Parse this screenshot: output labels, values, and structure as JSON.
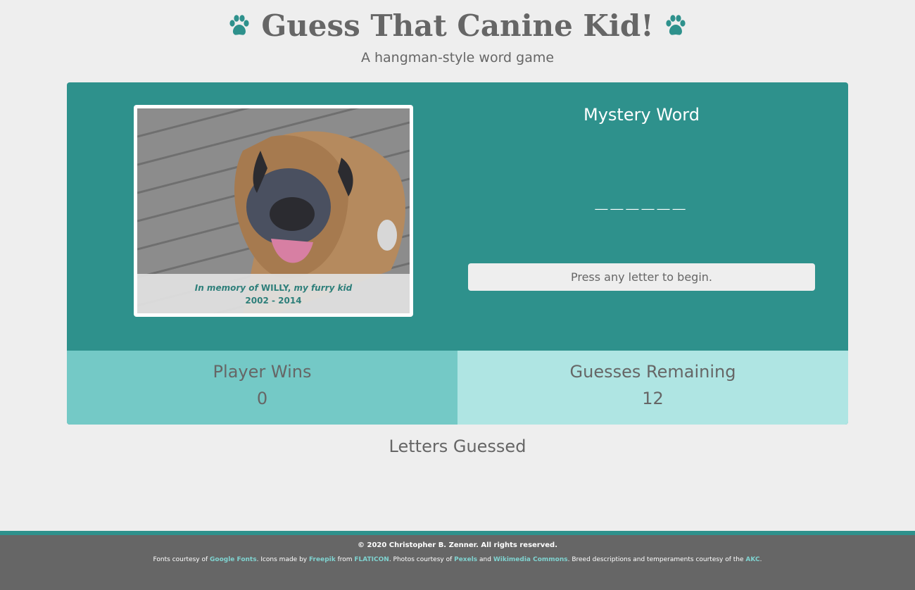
{
  "header": {
    "title": "Guess That Canine Kid!",
    "subtitle": "A hangman-style word game",
    "left_icon": "paw-icon",
    "right_icon": "paw-icon"
  },
  "photo": {
    "caption_line1_a": "In memory of ",
    "caption_line1_b": "WILLY,",
    "caption_line1_c": " my furry kid",
    "caption_line2": "2002 - 2014"
  },
  "game": {
    "mystery_title": "Mystery Word",
    "mystery_word": "______",
    "message": "Press any letter to begin.",
    "wins_label": "Player Wins",
    "wins_value": "0",
    "guesses_label": "Guesses Remaining",
    "guesses_value": "12",
    "letters_label": "Letters Guessed",
    "letters_value": ""
  },
  "footer": {
    "copyright": "© 2020 Christopher B. Zenner. All rights reserved.",
    "fonts_prefix": "Fonts courtesy of ",
    "google_fonts": "Google Fonts",
    "icons_prefix": ". Icons made by ",
    "freepik": "Freepik",
    "from_text": " from ",
    "flaticon": "FLATICON",
    "photos_prefix": ". Photos courtesy of ",
    "pexels": "Pexels",
    "and_text": " and ",
    "wikimedia": "Wikimedia Commons",
    "breed_text": ". Breed descriptions and temperaments courtesy of the ",
    "akc": "AKC",
    "end_text": "."
  },
  "colors": {
    "accent": "#2e918c",
    "wins_bg": "#74c9c6",
    "guesses_bg": "#afe5e3",
    "footer_bg": "#666666",
    "page_bg": "#eeeeee"
  }
}
